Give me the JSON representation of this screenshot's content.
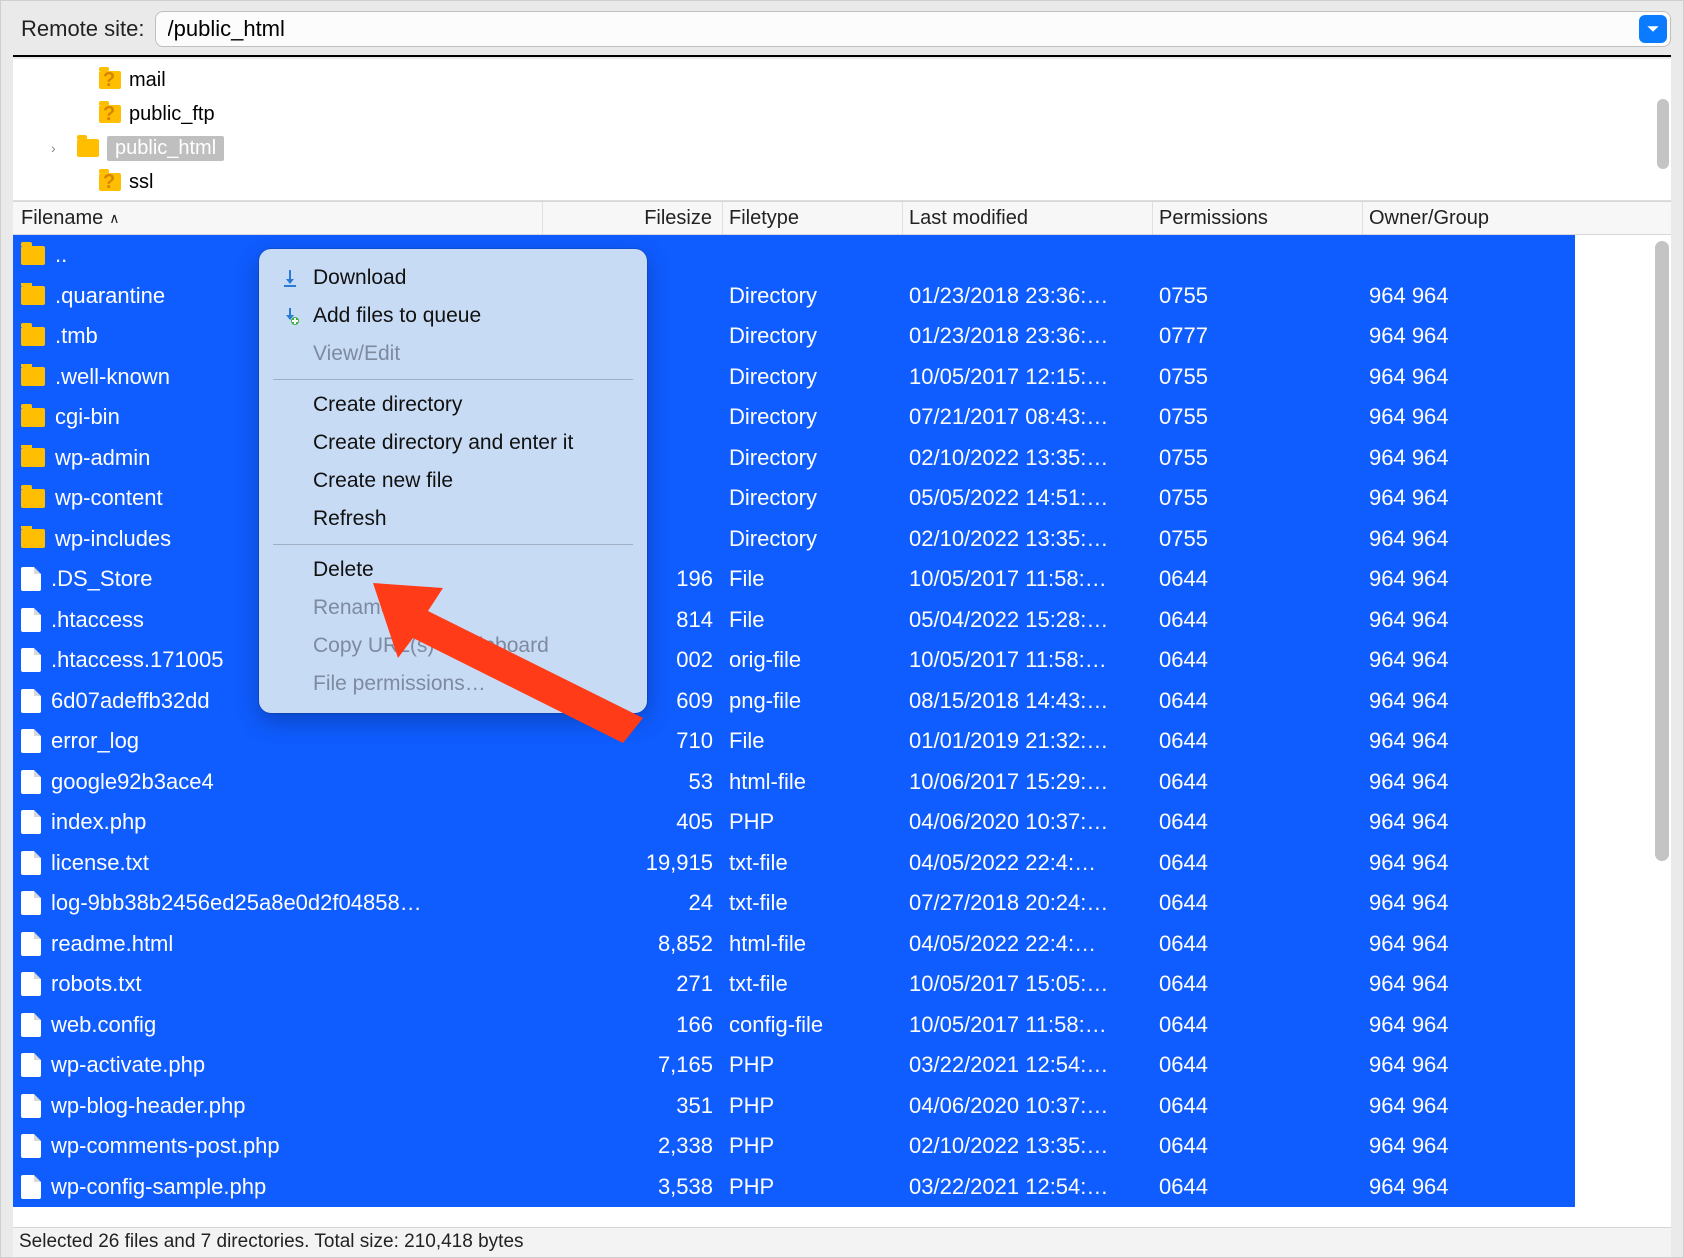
{
  "path_bar": {
    "label": "Remote site:",
    "value": "/public_html"
  },
  "tree": {
    "items": [
      {
        "name": "mail",
        "unknown": true
      },
      {
        "name": "public_ftp",
        "unknown": true
      },
      {
        "name": "public_html",
        "unknown": false,
        "selected": true,
        "has_children": true
      },
      {
        "name": "ssl",
        "unknown": true
      }
    ]
  },
  "columns": {
    "name": "Filename",
    "size": "Filesize",
    "type": "Filetype",
    "modified": "Last modified",
    "permissions": "Permissions",
    "owner": "Owner/Group"
  },
  "rows": [
    {
      "icon": "folder",
      "name": "..",
      "size": "",
      "type": "",
      "mod": "",
      "perm": "",
      "own": ""
    },
    {
      "icon": "folder",
      "name": ".quarantine",
      "size": "",
      "type": "Directory",
      "mod": "01/23/2018 23:36:…",
      "perm": "0755",
      "own": "964 964"
    },
    {
      "icon": "folder",
      "name": ".tmb",
      "size": "",
      "type": "Directory",
      "mod": "01/23/2018 23:36:…",
      "perm": "0777",
      "own": "964 964"
    },
    {
      "icon": "folder",
      "name": ".well-known",
      "size": "",
      "type": "Directory",
      "mod": "10/05/2017 12:15:…",
      "perm": "0755",
      "own": "964 964"
    },
    {
      "icon": "folder",
      "name": "cgi-bin",
      "size": "",
      "type": "Directory",
      "mod": "07/21/2017 08:43:…",
      "perm": "0755",
      "own": "964 964"
    },
    {
      "icon": "folder",
      "name": "wp-admin",
      "size": "",
      "type": "Directory",
      "mod": "02/10/2022 13:35:…",
      "perm": "0755",
      "own": "964 964"
    },
    {
      "icon": "folder",
      "name": "wp-content",
      "size": "",
      "type": "Directory",
      "mod": "05/05/2022 14:51:…",
      "perm": "0755",
      "own": "964 964"
    },
    {
      "icon": "folder",
      "name": "wp-includes",
      "size": "",
      "type": "Directory",
      "mod": "02/10/2022 13:35:…",
      "perm": "0755",
      "own": "964 964"
    },
    {
      "icon": "file",
      "name": ".DS_Store",
      "size": "196",
      "type": "File",
      "mod": "10/05/2017 11:58:…",
      "perm": "0644",
      "own": "964 964"
    },
    {
      "icon": "file",
      "name": ".htaccess",
      "size": "814",
      "type": "File",
      "mod": "05/04/2022 15:28:…",
      "perm": "0644",
      "own": "964 964"
    },
    {
      "icon": "file",
      "name": ".htaccess.171005",
      "size": "002",
      "type": "orig-file",
      "mod": "10/05/2017 11:58:…",
      "perm": "0644",
      "own": "964 964"
    },
    {
      "icon": "file",
      "name": "6d07adeffb32dd",
      "size": "609",
      "type": "png-file",
      "mod": "08/15/2018 14:43:…",
      "perm": "0644",
      "own": "964 964"
    },
    {
      "icon": "file",
      "name": "error_log",
      "size": "710",
      "type": "File",
      "mod": "01/01/2019 21:32:…",
      "perm": "0644",
      "own": "964 964"
    },
    {
      "icon": "file",
      "name": "google92b3ace4",
      "size": "53",
      "type": "html-file",
      "mod": "10/06/2017 15:29:…",
      "perm": "0644",
      "own": "964 964"
    },
    {
      "icon": "file",
      "name": "index.php",
      "size": "405",
      "type": "PHP",
      "mod": "04/06/2020 10:37:…",
      "perm": "0644",
      "own": "964 964"
    },
    {
      "icon": "file",
      "name": "license.txt",
      "size": "19,915",
      "type": "txt-file",
      "mod": "04/05/2022 22:4:…",
      "perm": "0644",
      "own": "964 964"
    },
    {
      "icon": "file",
      "name": "log-9bb38b2456ed25a8e0d2f04858…",
      "size": "24",
      "type": "txt-file",
      "mod": "07/27/2018 20:24:…",
      "perm": "0644",
      "own": "964 964"
    },
    {
      "icon": "file",
      "name": "readme.html",
      "size": "8,852",
      "type": "html-file",
      "mod": "04/05/2022 22:4:…",
      "perm": "0644",
      "own": "964 964"
    },
    {
      "icon": "file",
      "name": "robots.txt",
      "size": "271",
      "type": "txt-file",
      "mod": "10/05/2017 15:05:…",
      "perm": "0644",
      "own": "964 964"
    },
    {
      "icon": "file",
      "name": "web.config",
      "size": "166",
      "type": "config-file",
      "mod": "10/05/2017 11:58:…",
      "perm": "0644",
      "own": "964 964"
    },
    {
      "icon": "file",
      "name": "wp-activate.php",
      "size": "7,165",
      "type": "PHP",
      "mod": "03/22/2021 12:54:…",
      "perm": "0644",
      "own": "964 964"
    },
    {
      "icon": "file",
      "name": "wp-blog-header.php",
      "size": "351",
      "type": "PHP",
      "mod": "04/06/2020 10:37:…",
      "perm": "0644",
      "own": "964 964"
    },
    {
      "icon": "file",
      "name": "wp-comments-post.php",
      "size": "2,338",
      "type": "PHP",
      "mod": "02/10/2022 13:35:…",
      "perm": "0644",
      "own": "964 964"
    },
    {
      "icon": "file",
      "name": "wp-config-sample.php",
      "size": "3,538",
      "type": "PHP",
      "mod": "03/22/2021 12:54:…",
      "perm": "0644",
      "own": "964 964"
    }
  ],
  "context_menu": {
    "download": "Download",
    "add_queue": "Add files to queue",
    "view_edit": "View/Edit",
    "create_dir": "Create directory",
    "create_dir_enter": "Create directory and enter it",
    "create_file": "Create new file",
    "refresh": "Refresh",
    "delete": "Delete",
    "rename": "Rename",
    "copy_urls": "Copy URL(s) to clipboard",
    "file_perms": "File permissions…"
  },
  "status": "Selected 26 files and 7 directories. Total size: 210,418 bytes"
}
